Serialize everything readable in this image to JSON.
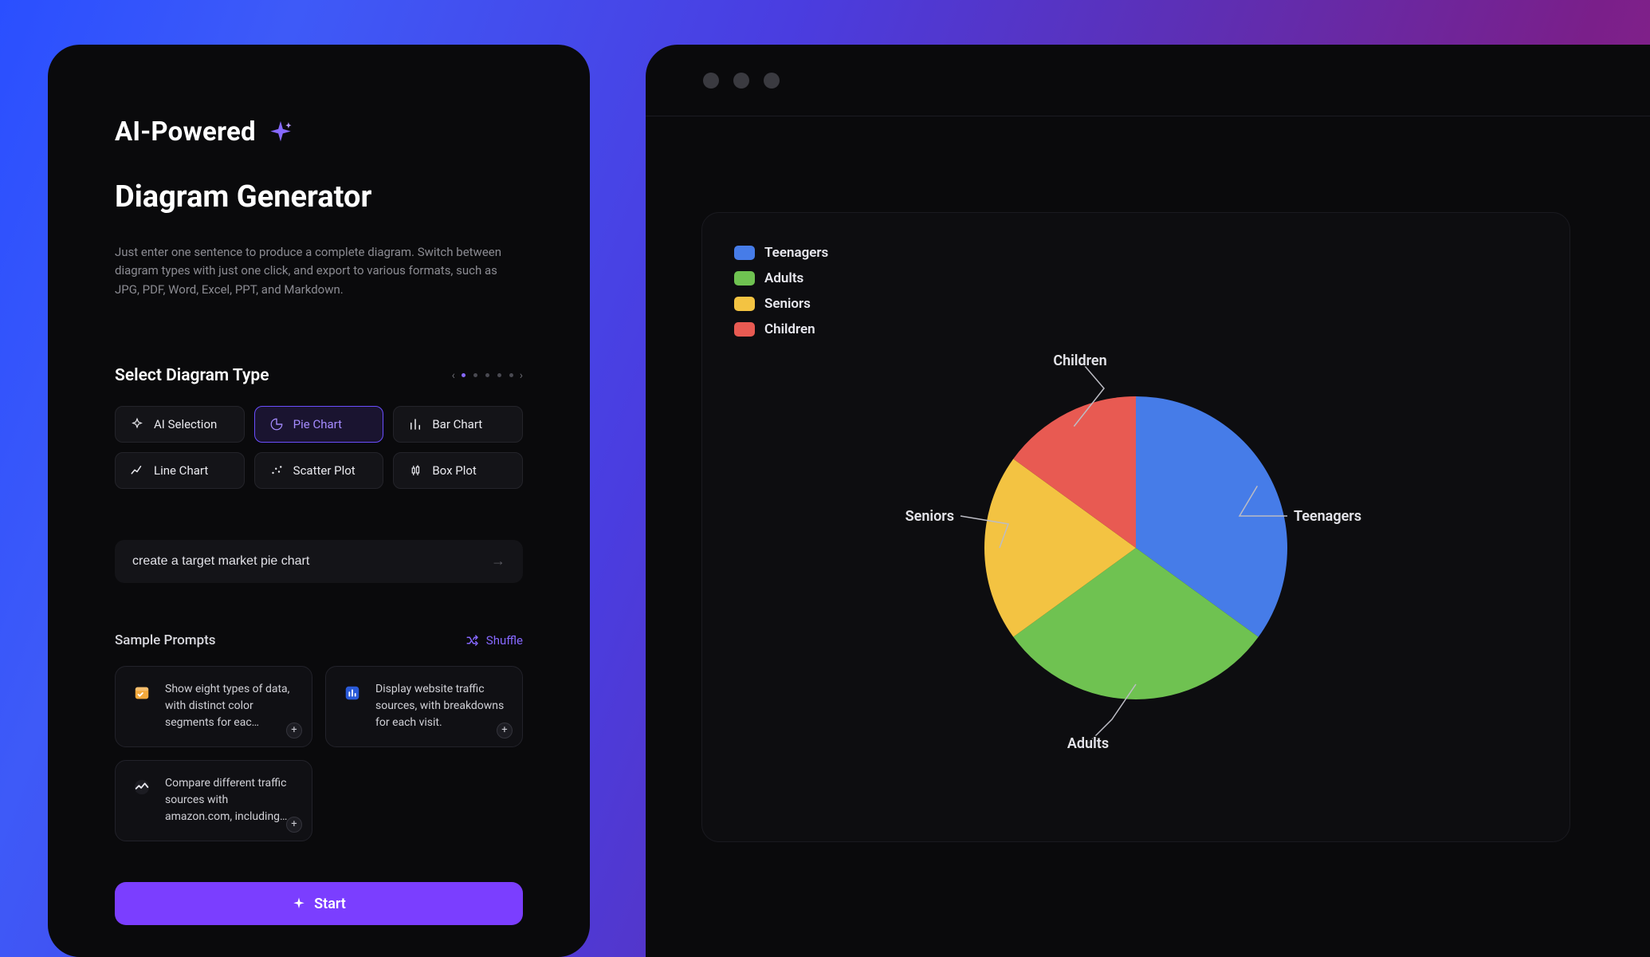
{
  "header": {
    "badge": "AI-Powered",
    "title": "Diagram Generator",
    "description": "Just enter one sentence to produce a complete diagram. Switch between diagram types with just one click, and export to various formats, such as JPG, PDF, Word, Excel, PPT, and Markdown."
  },
  "diagram_types": {
    "section_title": "Select Diagram Type",
    "items": [
      {
        "id": "ai-selection",
        "label": "AI Selection",
        "selected": false
      },
      {
        "id": "pie-chart",
        "label": "Pie Chart",
        "selected": true
      },
      {
        "id": "bar-chart",
        "label": "Bar Chart",
        "selected": false
      },
      {
        "id": "line-chart",
        "label": "Line Chart",
        "selected": false
      },
      {
        "id": "scatter-plot",
        "label": "Scatter Plot",
        "selected": false
      },
      {
        "id": "box-plot",
        "label": "Box Plot",
        "selected": false
      }
    ]
  },
  "prompt": {
    "value": "create a target market pie chart"
  },
  "samples": {
    "section_title": "Sample Prompts",
    "shuffle_label": "Shuffle",
    "items": [
      {
        "text": "Show eight types of data, with distinct color segments for eac…"
      },
      {
        "text": "Display website traffic sources, with breakdowns for each visit."
      },
      {
        "text": "Compare different traffic sources with amazon.com, including…"
      }
    ]
  },
  "actions": {
    "start_label": "Start"
  },
  "chart_data": {
    "type": "pie",
    "title": "",
    "series": [
      {
        "name": "Teenagers",
        "value": 35,
        "color": "#467ce8"
      },
      {
        "name": "Adults",
        "value": 30,
        "color": "#6fc251"
      },
      {
        "name": "Seniors",
        "value": 20,
        "color": "#f3c342"
      },
      {
        "name": "Children",
        "value": 15,
        "color": "#e85a52"
      }
    ],
    "legend_position": "top-left"
  }
}
